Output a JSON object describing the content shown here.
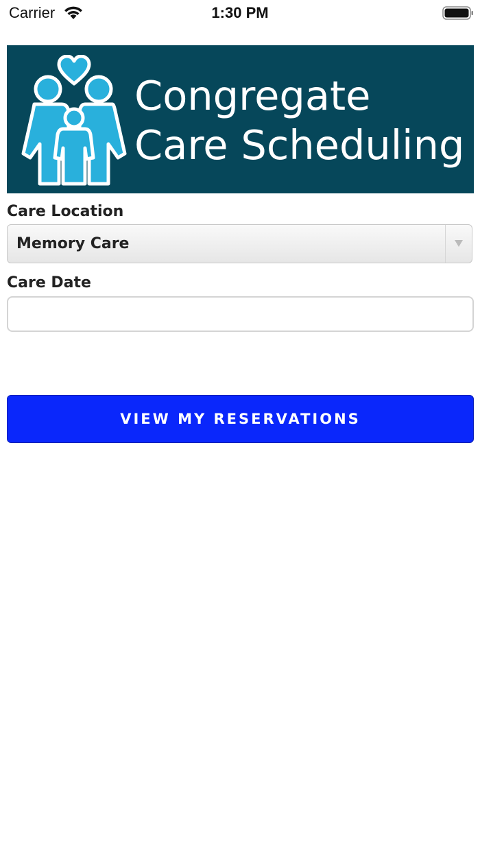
{
  "status_bar": {
    "carrier": "Carrier",
    "time": "1:30 PM",
    "wifi_icon": "wifi-icon",
    "battery_icon": "battery-icon"
  },
  "banner": {
    "title_line1": "Congregate",
    "title_line2": "Care Scheduling",
    "logo_icon": "family-heart-icon",
    "background_color": "#06475a",
    "logo_color": "#29b0dc"
  },
  "form": {
    "location_label": "Care Location",
    "location_value": "Memory Care",
    "date_label": "Care Date",
    "date_value": ""
  },
  "actions": {
    "view_reservations_label": "VIEW MY RESERVATIONS",
    "button_color": "#0a27fb"
  }
}
